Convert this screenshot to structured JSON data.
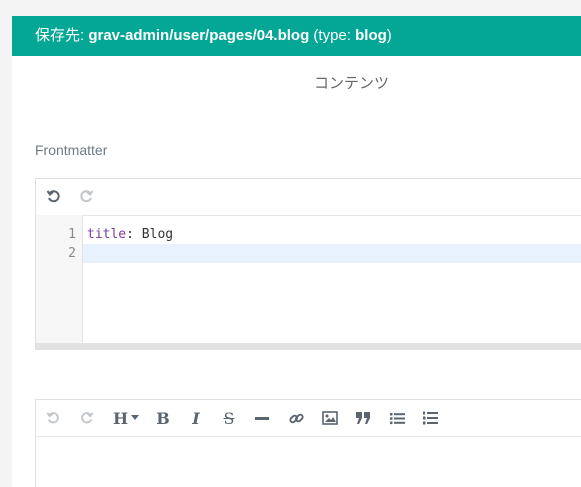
{
  "header": {
    "prefix": "保存先: ",
    "path": "grav-admin/user/pages/04.blog",
    "type_open": " (type: ",
    "type_value": "blog",
    "type_close": ")",
    "bg_color": "#04a696"
  },
  "tabs": {
    "content_label": "コンテンツ"
  },
  "frontmatter": {
    "label": "Frontmatter",
    "toolbar": [
      {
        "name": "undo-icon",
        "state": "enabled"
      },
      {
        "name": "redo-icon",
        "state": "disabled"
      }
    ],
    "lines": [
      {
        "number": "1",
        "key": "title",
        "sep": ": ",
        "value": "Blog"
      },
      {
        "number": "2",
        "key": "",
        "sep": "",
        "value": ""
      }
    ],
    "active_line": "2"
  },
  "markdown_toolbar": {
    "heading_label": "H",
    "bold_label": "B",
    "italic_label": "I",
    "strike_label": "S",
    "buttons": [
      "undo-icon",
      "redo-icon",
      "heading-icon",
      "bold-icon",
      "italic-icon",
      "strikethrough-icon",
      "horizontal-rule-icon",
      "link-icon",
      "image-icon",
      "quote-icon",
      "unordered-list-icon",
      "ordered-list-icon"
    ]
  }
}
